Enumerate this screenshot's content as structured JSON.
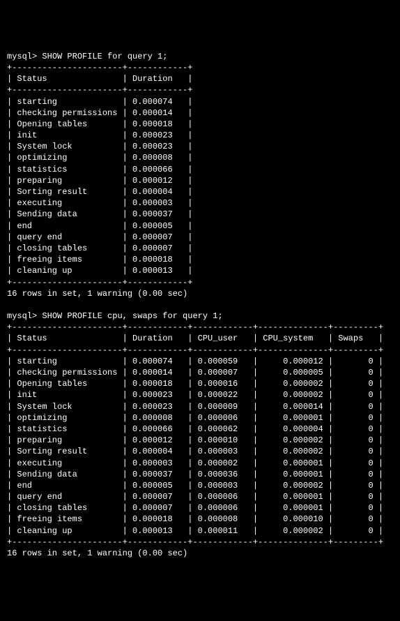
{
  "prompt": "mysql>",
  "query1": {
    "command": "SHOW PROFILE for query 1;",
    "columns": [
      "Status",
      "Duration"
    ],
    "widths": [
      20,
      10
    ],
    "align": [
      "left",
      "left"
    ],
    "rows": [
      {
        "status": "starting",
        "duration": "0.000074"
      },
      {
        "status": "checking permissions",
        "duration": "0.000014"
      },
      {
        "status": "Opening tables",
        "duration": "0.000018"
      },
      {
        "status": "init",
        "duration": "0.000023"
      },
      {
        "status": "System lock",
        "duration": "0.000023"
      },
      {
        "status": "optimizing",
        "duration": "0.000008"
      },
      {
        "status": "statistics",
        "duration": "0.000066"
      },
      {
        "status": "preparing",
        "duration": "0.000012"
      },
      {
        "status": "Sorting result",
        "duration": "0.000004"
      },
      {
        "status": "executing",
        "duration": "0.000003"
      },
      {
        "status": "Sending data",
        "duration": "0.000037"
      },
      {
        "status": "end",
        "duration": "0.000005"
      },
      {
        "status": "query end",
        "duration": "0.000007"
      },
      {
        "status": "closing tables",
        "duration": "0.000007"
      },
      {
        "status": "freeing items",
        "duration": "0.000018"
      },
      {
        "status": "cleaning up",
        "duration": "0.000013"
      }
    ],
    "footer": "16 rows in set, 1 warning (0.00 sec)"
  },
  "query2": {
    "command": "SHOW PROFILE cpu, swaps for query 1;",
    "columns": [
      "Status",
      "Duration",
      "CPU_user",
      "CPU_system",
      "Swaps"
    ],
    "widths": [
      20,
      10,
      10,
      12,
      7
    ],
    "align": [
      "left",
      "left",
      "left",
      "right",
      "right"
    ],
    "rows": [
      {
        "status": "starting",
        "duration": "0.000074",
        "cpu_user": "0.000059",
        "cpu_system": "0.000012",
        "swaps": "0"
      },
      {
        "status": "checking permissions",
        "duration": "0.000014",
        "cpu_user": "0.000007",
        "cpu_system": "0.000005",
        "swaps": "0"
      },
      {
        "status": "Opening tables",
        "duration": "0.000018",
        "cpu_user": "0.000016",
        "cpu_system": "0.000002",
        "swaps": "0"
      },
      {
        "status": "init",
        "duration": "0.000023",
        "cpu_user": "0.000022",
        "cpu_system": "0.000002",
        "swaps": "0"
      },
      {
        "status": "System lock",
        "duration": "0.000023",
        "cpu_user": "0.000009",
        "cpu_system": "0.000014",
        "swaps": "0"
      },
      {
        "status": "optimizing",
        "duration": "0.000008",
        "cpu_user": "0.000006",
        "cpu_system": "0.000001",
        "swaps": "0"
      },
      {
        "status": "statistics",
        "duration": "0.000066",
        "cpu_user": "0.000062",
        "cpu_system": "0.000004",
        "swaps": "0"
      },
      {
        "status": "preparing",
        "duration": "0.000012",
        "cpu_user": "0.000010",
        "cpu_system": "0.000002",
        "swaps": "0"
      },
      {
        "status": "Sorting result",
        "duration": "0.000004",
        "cpu_user": "0.000003",
        "cpu_system": "0.000002",
        "swaps": "0"
      },
      {
        "status": "executing",
        "duration": "0.000003",
        "cpu_user": "0.000002",
        "cpu_system": "0.000001",
        "swaps": "0"
      },
      {
        "status": "Sending data",
        "duration": "0.000037",
        "cpu_user": "0.000036",
        "cpu_system": "0.000001",
        "swaps": "0"
      },
      {
        "status": "end",
        "duration": "0.000005",
        "cpu_user": "0.000003",
        "cpu_system": "0.000002",
        "swaps": "0"
      },
      {
        "status": "query end",
        "duration": "0.000007",
        "cpu_user": "0.000006",
        "cpu_system": "0.000001",
        "swaps": "0"
      },
      {
        "status": "closing tables",
        "duration": "0.000007",
        "cpu_user": "0.000006",
        "cpu_system": "0.000001",
        "swaps": "0"
      },
      {
        "status": "freeing items",
        "duration": "0.000018",
        "cpu_user": "0.000008",
        "cpu_system": "0.000010",
        "swaps": "0"
      },
      {
        "status": "cleaning up",
        "duration": "0.000013",
        "cpu_user": "0.000011",
        "cpu_system": "0.000002",
        "swaps": "0"
      }
    ],
    "footer": "16 rows in set, 1 warning (0.00 sec)"
  }
}
